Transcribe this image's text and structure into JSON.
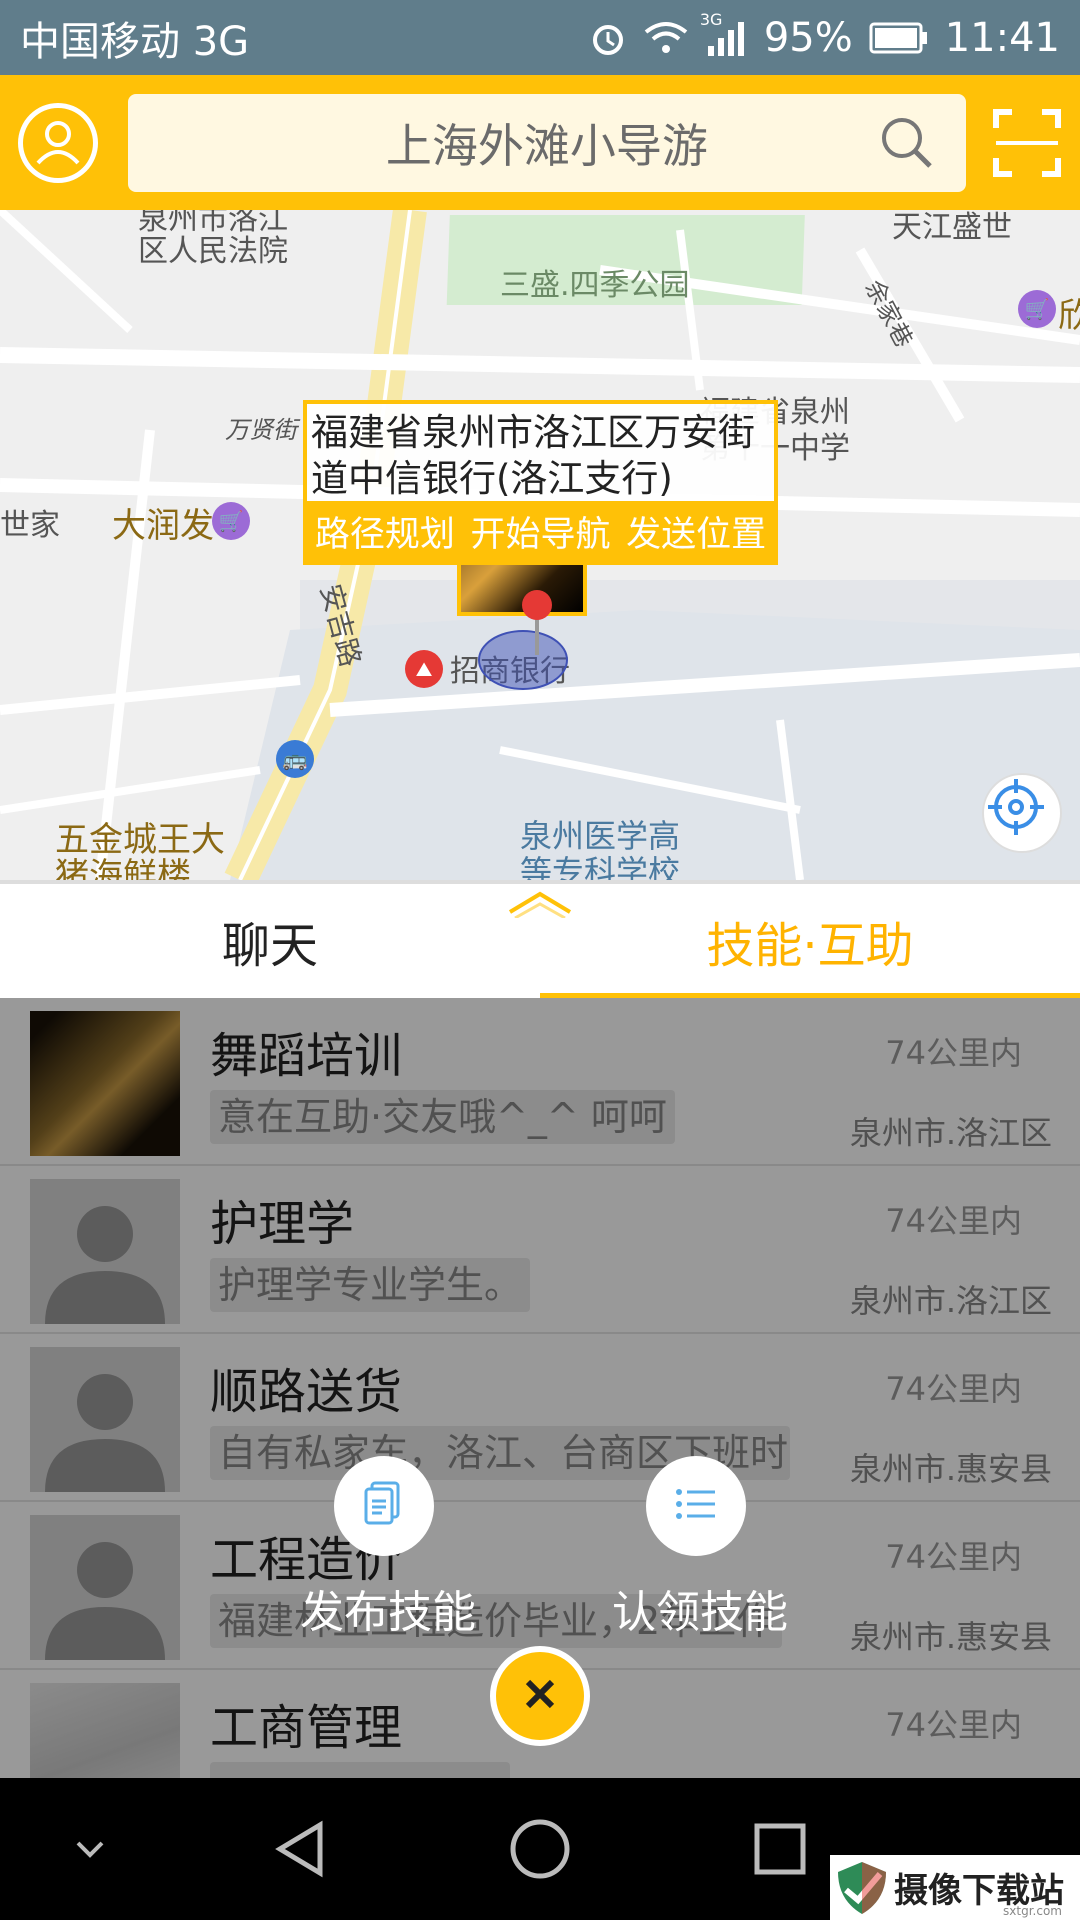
{
  "status_bar": {
    "carrier": "中国移动 3G",
    "network": "3G",
    "battery": "95%",
    "time": "11:41"
  },
  "search": {
    "query": "上海外滩小导游"
  },
  "map": {
    "labels": {
      "court": "泉州市洛江\n区人民法院",
      "park": "三盛.四季公园",
      "tianjiang": "天江盛世",
      "school_name": "福建省泉州\n第十一中学",
      "road_wanxian": "万贤街",
      "shijia": "世家",
      "darunfa": "大润发",
      "road_anji": "安吉路",
      "road_yujia": "余家巷",
      "bank": "招商银行",
      "hospital_school": "泉州医学高\n等专科学校",
      "wujincheng": "五金城王大\n猪海鲜楼",
      "right_edge": "欣"
    },
    "popup": {
      "address": "福建省泉州市洛江区万安街道中信银行(洛江支行)",
      "actions": [
        "路径规划",
        "开始导航",
        "发送位置"
      ]
    }
  },
  "tabs": [
    {
      "label": "聊天",
      "active": false
    },
    {
      "label": "技能·互助",
      "active": true
    }
  ],
  "list": [
    {
      "title": "舞蹈培训",
      "desc": "意在互助·交友哦^_^ 呵呵",
      "distance": "74公里内",
      "area": "泉州市.洛江区",
      "avatar": "leopard"
    },
    {
      "title": "护理学",
      "desc": "护理学专业学生。",
      "distance": "74公里内",
      "area": "泉州市.洛江区",
      "avatar": "default"
    },
    {
      "title": "顺路送货",
      "desc": "自有私家车，洛江、台商区下班时",
      "distance": "74公里内",
      "area": "泉州市.惠安县",
      "avatar": "default"
    },
    {
      "title": "工程造价",
      "desc": "福建林业工程造价毕业，2年工作",
      "distance": "74公里内",
      "area": "泉州市.惠安县",
      "avatar": "default"
    },
    {
      "title": "工商管理",
      "desc": "",
      "distance": "74公里内",
      "area": "",
      "avatar": "photo"
    }
  ],
  "fab_menu": {
    "publish": "发布技能",
    "claim": "认领技能"
  },
  "watermark": {
    "title": "摄像下载站",
    "site": "sxtgr.com"
  },
  "colors": {
    "accent": "#ffc107",
    "status_bar": "#607d8b",
    "nav_bar": "#000000"
  },
  "icons": {
    "user": "user-icon",
    "search": "search-icon",
    "scan": "scan-icon",
    "locate": "locate-icon",
    "publish": "document-icon",
    "claim": "list-icon",
    "close": "close-icon"
  }
}
